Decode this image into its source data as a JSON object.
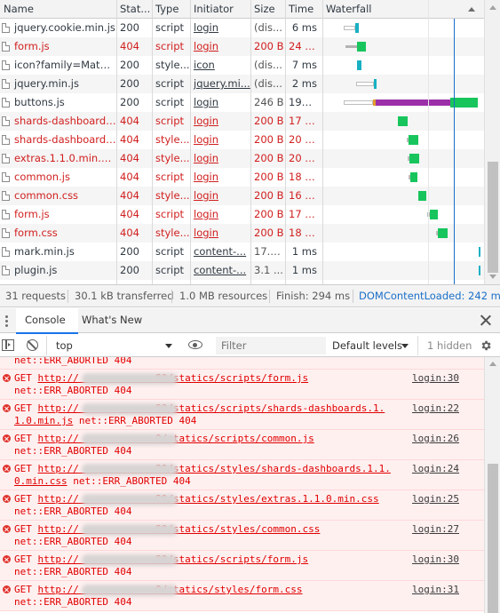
{
  "network": {
    "headers": {
      "name": "Name",
      "status": "Stat...",
      "type": "Type",
      "initiator": "Initiator",
      "size": "Size",
      "time": "Time",
      "waterfall": "Waterfall"
    },
    "rows": [
      {
        "name": "jquery.cookie.min.js",
        "status": "200",
        "type": "script",
        "initiator": "login",
        "size": "(dis...",
        "time": "6 ms",
        "error": false
      },
      {
        "name": "form.js",
        "status": "404",
        "type": "script",
        "initiator": "login",
        "size": "200 B",
        "time": "24 ms",
        "error": true
      },
      {
        "name": "icon?family=Mater...",
        "status": "200",
        "type": "style...",
        "initiator": "icon",
        "size": "(dis...",
        "time": "7 ms",
        "error": false
      },
      {
        "name": "jquery.min.js",
        "status": "200",
        "type": "script",
        "initiator": "jquery.mi...",
        "size": "(dis...",
        "time": "2 ms",
        "error": false
      },
      {
        "name": "buttons.js",
        "status": "200",
        "type": "script",
        "initiator": "login",
        "size": "246 B",
        "time": "194 ...",
        "error": false
      },
      {
        "name": "shards-dashboards....",
        "status": "404",
        "type": "script",
        "initiator": "login",
        "size": "200 B",
        "time": "17 ms",
        "error": true
      },
      {
        "name": "shards-dashboards....",
        "status": "404",
        "type": "style...",
        "initiator": "login",
        "size": "200 B",
        "time": "20 ms",
        "error": true
      },
      {
        "name": "extras.1.1.0.min.css",
        "status": "404",
        "type": "style...",
        "initiator": "login",
        "size": "200 B",
        "time": "20 ms",
        "error": true
      },
      {
        "name": "common.js",
        "status": "404",
        "type": "script",
        "initiator": "login",
        "size": "200 B",
        "time": "18 ms",
        "error": true
      },
      {
        "name": "common.css",
        "status": "404",
        "type": "style...",
        "initiator": "login",
        "size": "200 B",
        "time": "16 ms",
        "error": true
      },
      {
        "name": "form.js",
        "status": "404",
        "type": "script",
        "initiator": "login",
        "size": "200 B",
        "time": "17 ms",
        "error": true
      },
      {
        "name": "form.css",
        "status": "404",
        "type": "style...",
        "initiator": "login",
        "size": "200 B",
        "time": "18 ms",
        "error": true
      },
      {
        "name": "mark.min.js",
        "status": "200",
        "type": "script",
        "initiator": "content-...",
        "size": "17.7...",
        "time": "1 ms",
        "error": false
      },
      {
        "name": "plugin.js",
        "status": "200",
        "type": "script",
        "initiator": "content-...",
        "size": "3.1 ...",
        "time": "1 ms",
        "error": false
      }
    ],
    "colors": {
      "error": "#d11e1e",
      "dom_content_loaded": "#1a6fc9",
      "load": "#d11e1e",
      "green": "#17c55c",
      "teal": "#18b0c3",
      "purple": "#9b2fa8"
    }
  },
  "summary": {
    "requests": "31 requests",
    "transferred": "30.1 kB transferred",
    "resources": "1.0 MB resources",
    "finish": "Finish: 294 ms",
    "dom_content_loaded": "DOMContentLoaded: 242 ms"
  },
  "drawer": {
    "tabs": [
      {
        "label": "Console",
        "active": true
      },
      {
        "label": "What's New",
        "active": false
      }
    ]
  },
  "console_toolbar": {
    "context": "top",
    "filter_placeholder": "Filter",
    "levels": "Default levels",
    "hidden": "1 hidden"
  },
  "console": {
    "partial_line": "net::ERR_ABORTED 404",
    "messages": [
      {
        "method": "GET",
        "url_start": "http://",
        "url_rest": "80/statics/scripts/form.js",
        "url_wrap": "",
        "tail": "net::ERR_ABORTED 404",
        "source": "login:30"
      },
      {
        "method": "GET",
        "url_start": "http://",
        "url_rest": "80/statics/scripts/shards-dashboards.1.",
        "url_wrap": "1.0.min.js",
        "tail": "net::ERR_ABORTED 404",
        "source": "login:22"
      },
      {
        "method": "GET",
        "url_start": "http://",
        "url_rest": "0/statics/scripts/common.js",
        "url_wrap": "",
        "tail": "net::ERR_ABORTED 404",
        "source": "login:26"
      },
      {
        "method": "GET",
        "url_start": "http://",
        "url_rest": "80/statics/styles/shards-dashboards.1.1.",
        "url_wrap": "0.min.css",
        "tail": "net::ERR_ABORTED 404",
        "source": "login:24"
      },
      {
        "method": "GET",
        "url_start": "http://",
        "url_rest": "80/statics/styles/extras.1.1.0.min.css",
        "url_wrap": "",
        "tail": "net::ERR_ABORTED 404",
        "source": "login:25"
      },
      {
        "method": "GET",
        "url_start": "http://",
        "url_rest": "80/statics/styles/common.css",
        "url_wrap": "",
        "tail": "net::ERR_ABORTED 404",
        "source": "login:27"
      },
      {
        "method": "GET",
        "url_start": "http://",
        "url_rest": "80/statics/scripts/form.js",
        "url_wrap": "",
        "tail": "net::ERR_ABORTED 404",
        "source": "login:30"
      },
      {
        "method": "GET",
        "url_start": "http://",
        "url_rest": "0/statics/styles/form.css",
        "url_wrap": "",
        "tail": "net::ERR_ABORTED 404",
        "source": "login:31"
      }
    ]
  }
}
